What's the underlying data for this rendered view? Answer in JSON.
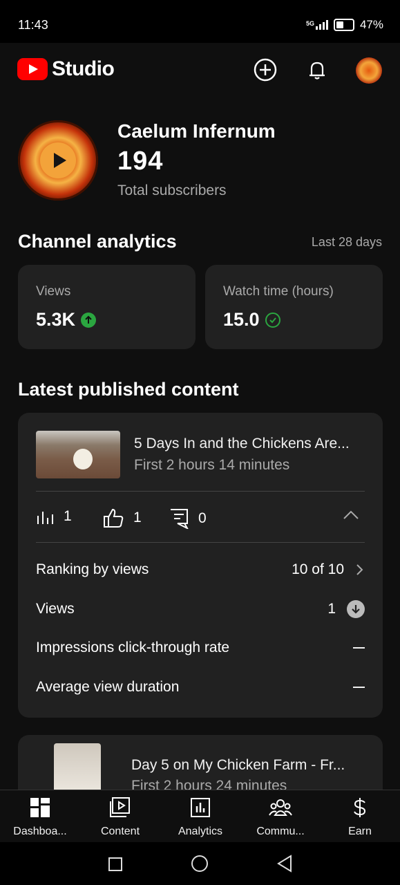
{
  "status_bar": {
    "time": "11:43",
    "network": "5G",
    "battery": "47%"
  },
  "header": {
    "brand": "Studio"
  },
  "channel": {
    "name": "Caelum Infernum",
    "subscribers": "194",
    "subscribers_label": "Total subscribers"
  },
  "analytics": {
    "title": "Channel analytics",
    "period": "Last 28 days",
    "views_label": "Views",
    "views_value": "5.3K",
    "watch_label": "Watch time (hours)",
    "watch_value": "15.0"
  },
  "latest": {
    "title": "Latest published content",
    "video1": {
      "title": "5 Days In and the Chickens Are...",
      "meta": "First 2 hours 14 minutes",
      "views": "1",
      "likes": "1",
      "comments": "0",
      "rows": [
        {
          "label": "Ranking by views",
          "value": "10 of 10"
        },
        {
          "label": "Views",
          "value": "1"
        },
        {
          "label": "Impressions click-through rate",
          "value": ""
        },
        {
          "label": "Average view duration",
          "value": ""
        }
      ]
    },
    "video2": {
      "title": "Day 5 on My Chicken Farm - Fr...",
      "meta": "First 2 hours 24 minutes"
    }
  },
  "nav": [
    {
      "label": "Dashboa..."
    },
    {
      "label": "Content"
    },
    {
      "label": "Analytics"
    },
    {
      "label": "Commu..."
    },
    {
      "label": "Earn"
    }
  ]
}
